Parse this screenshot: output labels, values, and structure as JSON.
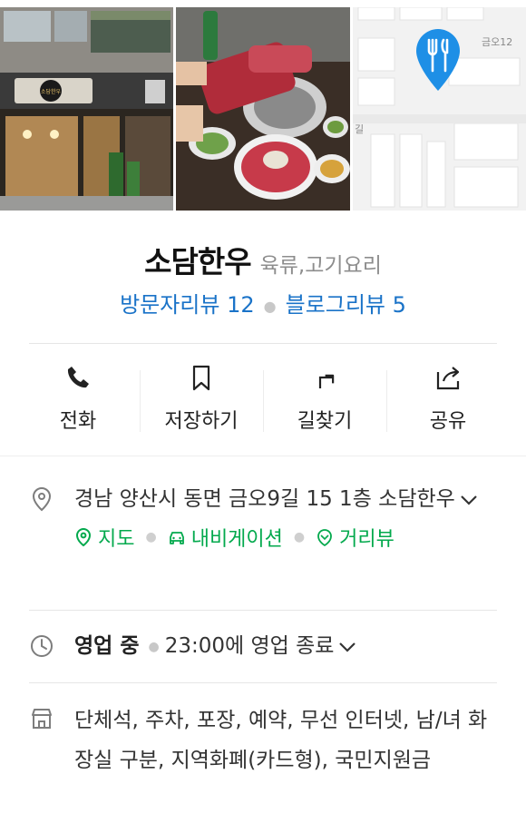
{
  "place": {
    "name": "소담한우",
    "category": "육류,고기요리"
  },
  "reviews": {
    "visitor": "방문자리뷰 12",
    "blog": "블로그리뷰 5"
  },
  "photos": {
    "storefront_sign": "소담한우",
    "map_street_label": "금오12",
    "map_street_label_2": "길"
  },
  "actions": [
    {
      "label": "전화",
      "icon": "phone-icon"
    },
    {
      "label": "저장하기",
      "icon": "bookmark-icon"
    },
    {
      "label": "길찾기",
      "icon": "directions-icon"
    },
    {
      "label": "공유",
      "icon": "share-icon"
    }
  ],
  "address": {
    "text": "경남 양산시 동면 금오9길 15 1층 소담한우",
    "links": [
      "지도",
      "내비게이션",
      "거리뷰"
    ]
  },
  "hours": {
    "status": "영업 중",
    "detail": "23:00에 영업 종료"
  },
  "facilities": {
    "text": "단체석, 주차, 포장, 예약, 무선 인터넷, 남/녀 화장실 구분, 지역화폐(카드형), 국민지원금"
  },
  "colors": {
    "link_blue": "#1a73c8",
    "accent_green": "#03a94d",
    "map_pin": "#1e8fe6"
  }
}
